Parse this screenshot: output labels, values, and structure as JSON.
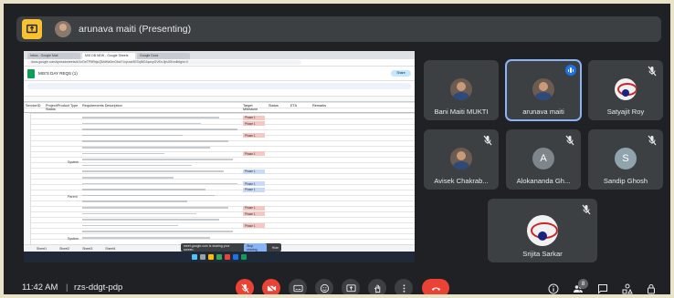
{
  "meeting": {
    "presenting_title": "arunava maiti (Presenting)",
    "time": "11:42 AM",
    "separator": "|",
    "meeting_code": "rzs-ddgt-pdp",
    "participant_count": "8"
  },
  "participants": [
    {
      "name": "Bani Maiti MUKTI",
      "muted": false,
      "avatar": "photo"
    },
    {
      "name": "arunava maiti",
      "muted": false,
      "speaking": true,
      "avatar": "photo"
    },
    {
      "name": "Satyajit Roy",
      "muted": true,
      "avatar": "logo"
    },
    {
      "name": "Avisek Chakrab...",
      "muted": true,
      "avatar": "photo"
    },
    {
      "name": "Alokananda Gh...",
      "muted": true,
      "avatar": "letter",
      "initial": "A"
    },
    {
      "name": "Sandip Ghosh",
      "muted": true,
      "avatar": "letter",
      "initial": "S"
    },
    {
      "name": "Srijita Sarkar",
      "muted": true,
      "avatar": "logo"
    }
  ],
  "shared_screen": {
    "browser_tabs": [
      "Inbox - Google Mail",
      "MIS DB NEW - Google Sheets",
      "Google Docs"
    ],
    "address": "docs.google.com/spreadsheets/d/1xOeTP6RbjuQMdHa0mGbaY1xyuuc9ESqf8OJqaxyGVEnJlpUSKedit#gid=0",
    "sheet_title": "MIS'S DAY REQS (1)",
    "share_label": "Share",
    "headers": [
      "ServiceID",
      "Project/Product Type Status",
      "Requirements Description",
      "Target Milestone",
      "Status",
      "ETA",
      "Remarks"
    ],
    "sections": [
      "System",
      "Parent",
      "System"
    ],
    "phase_label": "Phase 1",
    "sheet_tabs": [
      "Sheet1",
      "Sheet2",
      "Sheet3",
      "Sheet4"
    ],
    "stop_popup_text": "meet.google.com is sharing your screen.",
    "stop_button": "Stop sharing",
    "hide_button": "Hide"
  },
  "colors": {
    "background": "#202124",
    "tile": "#3c4043",
    "accent": "#8ab4f8",
    "end_call": "#ea4335",
    "present_icon": "#f9c12e"
  },
  "icons": [
    "present-icon",
    "mic-off-icon",
    "speaking-icon",
    "captions-icon",
    "emoji-icon",
    "present-now-icon",
    "hand-icon",
    "more-icon",
    "end-call-icon",
    "info-icon",
    "people-icon",
    "chat-icon",
    "activities-icon",
    "host-controls-icon"
  ]
}
